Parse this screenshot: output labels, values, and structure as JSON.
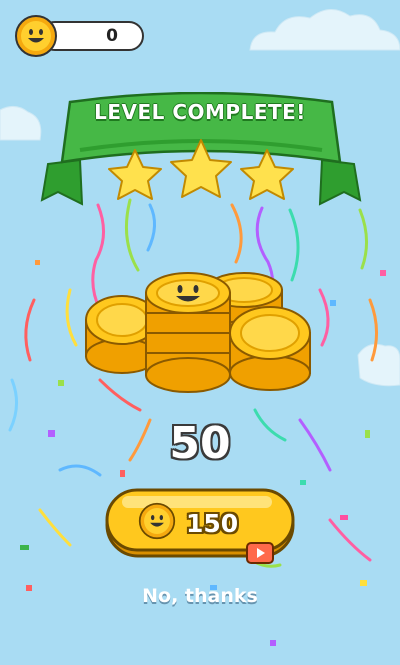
{
  "header": {
    "coin_count": "0"
  },
  "banner": {
    "title": "LEVEL COMPLETE!",
    "stars_earned": 3,
    "stars_total": 3
  },
  "reward": {
    "amount": "50"
  },
  "claim_button": {
    "amount": "150",
    "icon": "play-video-icon"
  },
  "skip": {
    "label": "No, thanks"
  },
  "colors": {
    "sky": "#a9dcf3",
    "banner_green": "#3fae3f",
    "coin_gold": "#ffc81e",
    "star_yellow": "#ffe14d",
    "ad_badge": "#ff6a4a"
  }
}
